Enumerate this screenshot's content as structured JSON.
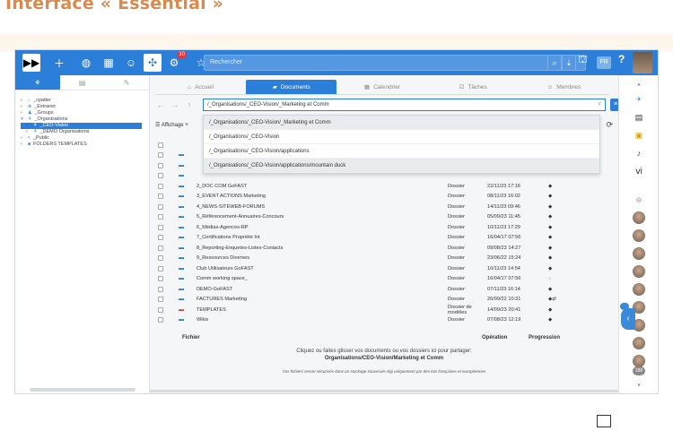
{
  "heading": "Interface « Essential »",
  "topbar": {
    "badge_count": "10",
    "search_placeholder": "Rechercher",
    "lang": "FR",
    "help": "?"
  },
  "left_panel": {
    "tree": [
      {
        "label": "_cpatter",
        "caret": "›",
        "icon": "⌂"
      },
      {
        "label": "_Extranet",
        "caret": "›",
        "icon": "⊕"
      },
      {
        "label": "_Groups",
        "caret": "›",
        "icon": "♟"
      },
      {
        "label": "_Organisations",
        "caret": "˅",
        "icon": "⚘"
      },
      {
        "label": "_CEO-Vision",
        "caret": "›",
        "icon": "⚘"
      },
      {
        "label": "_DEMO Organisations",
        "caret": "›",
        "icon": "⚘"
      },
      {
        "label": "_Public",
        "caret": "›",
        "icon": "<"
      },
      {
        "label": "FOLDERS TEMPLATES",
        "caret": "›",
        "icon": "■"
      }
    ]
  },
  "tabs": [
    "Accueil",
    "Documents",
    "Calendrier",
    "Tâches",
    "Membres"
  ],
  "path": {
    "current": "/_Organisations/_CEO-Vision/_Marketing et Comm",
    "options": [
      "/_Organisations/_CEO-Vision/_Marketing et Comm",
      "/_Organisations/_CEO-Vision",
      "/_Organisations/_CEO-Vision/applications",
      "/_Organisations/_CEO-Vision/applications/mountain duck"
    ]
  },
  "toolbar": {
    "affichage": "Affichage"
  },
  "files": [
    {
      "name": "2_DOC COM GoFAST",
      "type": "Dossier",
      "date": "22/11/23 17:16",
      "flag": "◆",
      "color": "#2c7fd9"
    },
    {
      "name": "3_EVENT ACTIONS Marketing",
      "type": "Dossier",
      "date": "08/11/23 16:02",
      "flag": "◆",
      "color": "#2c7fd9"
    },
    {
      "name": "4_NEWS-SITEWEB-FORUMS",
      "type": "Dossier",
      "date": "14/11/23 09:46",
      "flag": "◆",
      "color": "#2c7fd9"
    },
    {
      "name": "5_Référencement-Annuaires-Concours",
      "type": "Dossier",
      "date": "05/09/23 11:45",
      "flag": "◆",
      "color": "#2c7fd9"
    },
    {
      "name": "6_Médias-Agences-RP",
      "type": "Dossier",
      "date": "10/11/23 17:29",
      "flag": "◆",
      "color": "#2c7fd9"
    },
    {
      "name": "7_Certifications Propriété Int",
      "type": "Dossier",
      "date": "16/04/17 07:56",
      "flag": "◆",
      "color": "#2c7fd9"
    },
    {
      "name": "8_Reporting-Enquetes-Listes-Contacts",
      "type": "Dossier",
      "date": "09/08/23 14:27",
      "flag": "◆",
      "color": "#2c7fd9"
    },
    {
      "name": "9_Ressources Diverses",
      "type": "Dossier",
      "date": "23/06/22 15:24",
      "flag": "◆",
      "color": "#2c7fd9"
    },
    {
      "name": "Club Utilisateurs GoFAST",
      "type": "Dossier",
      "date": "10/11/23 14:54",
      "flag": "◆",
      "color": "#2c7fd9"
    },
    {
      "name": "Comm working space_",
      "type": "Dossier",
      "date": "16/04/17 07:56",
      "flag": "⌂",
      "color": "#2c7fd9"
    },
    {
      "name": "DEMO-GoFAST",
      "type": "Dossier",
      "date": "07/11/23 16:14",
      "flag": "◆",
      "color": "#2c7fd9"
    },
    {
      "name": "FACTURES Marketing",
      "type": "Dossier",
      "date": "26/09/22 10:31",
      "flag": "◆⇄",
      "color": "#2c7fd9"
    },
    {
      "name": "TEMPLATES",
      "type": "Dossier de modèles",
      "date": "14/09/23 20:41",
      "flag": "◆",
      "color": "#d64545"
    },
    {
      "name": "Wikis",
      "type": "Dossier",
      "date": "07/08/23 12:19",
      "flag": "◆",
      "color": "#2c7fd9"
    }
  ],
  "footer": {
    "col_file": "Fichier",
    "col_op": "Opération",
    "col_prog": "Progression",
    "drop_line1": "Cliquez ou faites glisser vos documents ou vos dossiers ici pour partager:",
    "drop_line2": "Organisations/CEO-Vision/Marketing et Comm",
    "drop_line3": "Vos fichiers seront sécurisés dans un stockage souverain régi uniquement par des lois françaises et européennes"
  },
  "right_bar": {
    "badge": "288"
  }
}
